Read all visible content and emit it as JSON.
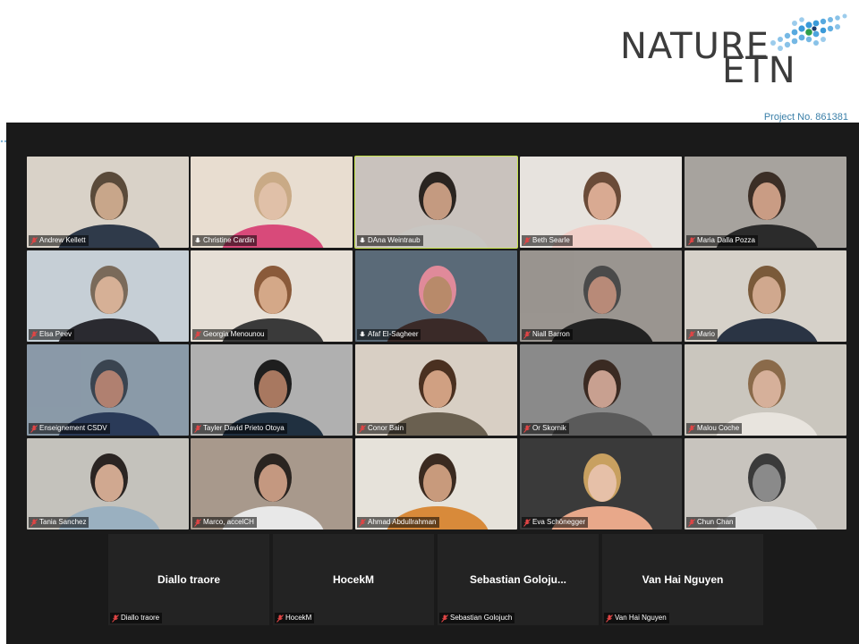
{
  "logo": {
    "line1": "NATURE",
    "line2": "ETN",
    "project": "Project No. 861381"
  },
  "colors": {
    "speaker_border": "#c7e34c",
    "meeting_bg": "#1a1a1a",
    "logo_blue": "#3a9ad9"
  },
  "participants": [
    {
      "name": "Andrew Kellett",
      "muted": true
    },
    {
      "name": "Christine Cardin",
      "muted": false
    },
    {
      "name": "DAna Weintraub",
      "muted": false,
      "active_speaker": true
    },
    {
      "name": "Beth Searle",
      "muted": true
    },
    {
      "name": "Maria Dalla Pozza",
      "muted": true
    },
    {
      "name": "Elsa Peev",
      "muted": true
    },
    {
      "name": "Georgia Menounou",
      "muted": true
    },
    {
      "name": "Afaf El-Sagheer",
      "muted": false
    },
    {
      "name": "Niall Barron",
      "muted": true
    },
    {
      "name": "Mario",
      "muted": true
    },
    {
      "name": "Enseignement CSDV",
      "muted": true
    },
    {
      "name": "Tayler David Prieto Otoya",
      "muted": true
    },
    {
      "name": "Conor Bain",
      "muted": true
    },
    {
      "name": "Or Skornik",
      "muted": true
    },
    {
      "name": "Malou Coche",
      "muted": true
    },
    {
      "name": "Tania Sanchez",
      "muted": true
    },
    {
      "name": "Marco, accelCH",
      "muted": true
    },
    {
      "name": "Ahmad Abdullrahman",
      "muted": true
    },
    {
      "name": "Eva Schönegger",
      "muted": true
    },
    {
      "name": "Chun Chan",
      "muted": true
    }
  ],
  "video_off": [
    {
      "display": "Diallo traore",
      "label": "Diallo traore"
    },
    {
      "display": "HocekM",
      "label": "HocekM"
    },
    {
      "display": "Sebastian  Goloju...",
      "label": "Sebastian Golojuch"
    },
    {
      "display": "Van Hai Nguyen",
      "label": "Van Hai Nguyen"
    }
  ],
  "icons": {
    "mic": "mic-muted-icon"
  }
}
